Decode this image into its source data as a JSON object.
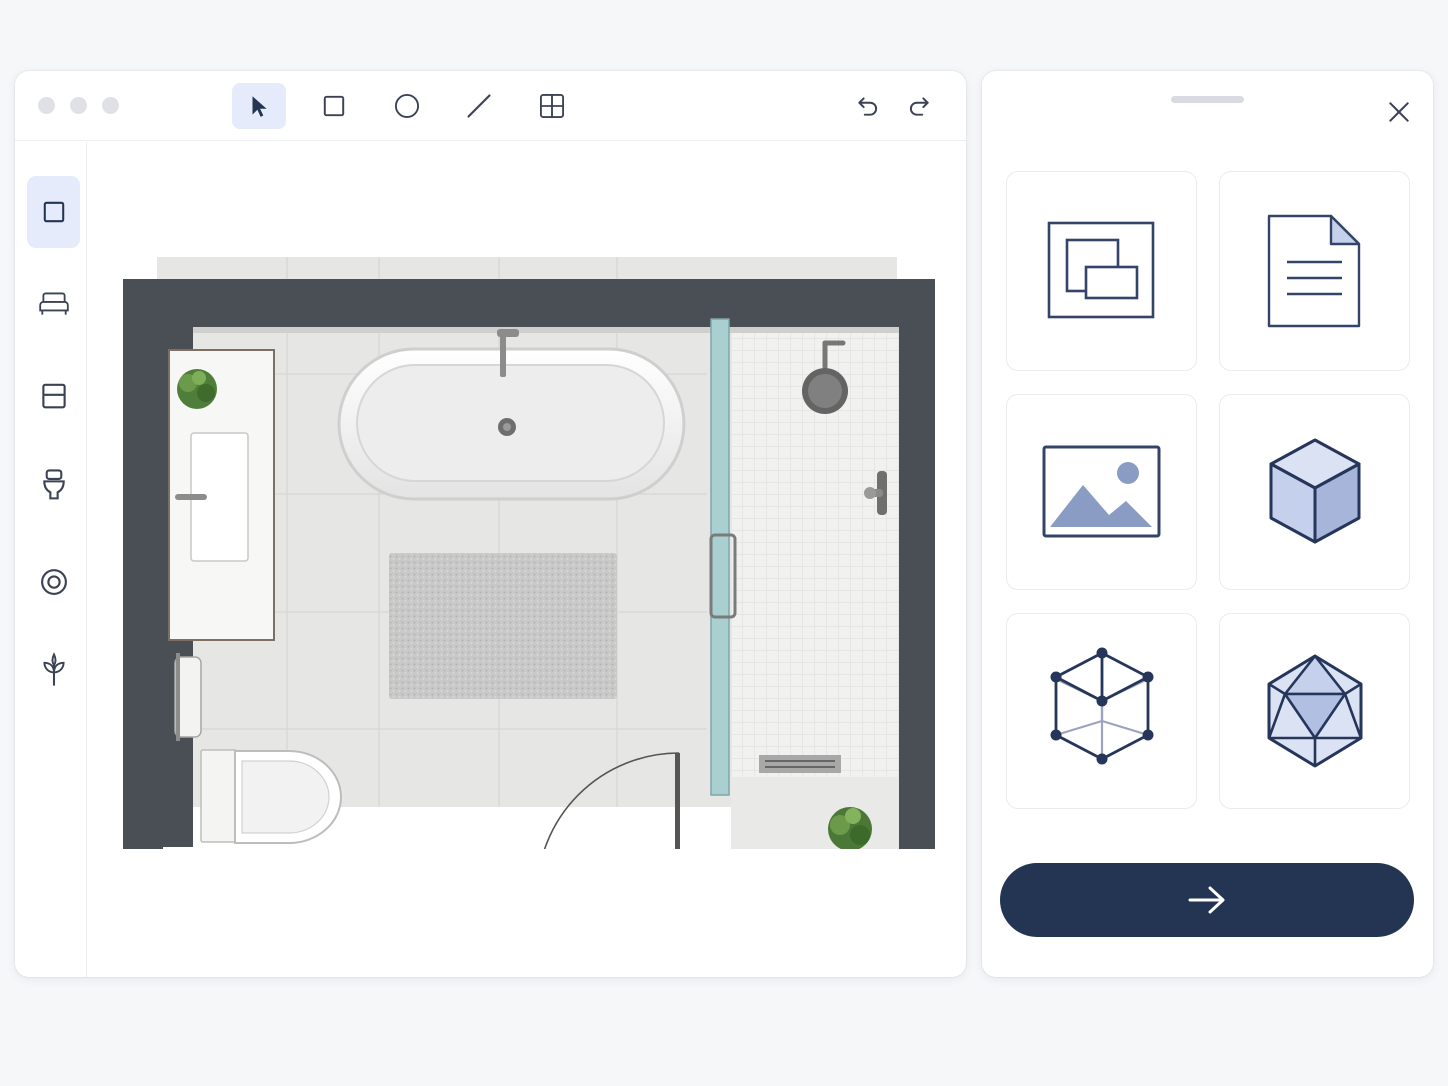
{
  "colors": {
    "accent": "#233553",
    "active_tool_bg": "#e5ebfb",
    "wall": "#4a4f56",
    "glass": "#a9cfd1",
    "icon_stroke": "#344468",
    "icon_fill": "#c5d0ec"
  },
  "window": {
    "controls": [
      "close-dot",
      "minimize-dot",
      "maximize-dot"
    ]
  },
  "toolbar": {
    "tools": [
      {
        "name": "select",
        "icon": "cursor-arrow-icon",
        "active": true
      },
      {
        "name": "rectangle",
        "icon": "square-icon",
        "active": false
      },
      {
        "name": "ellipse",
        "icon": "circle-icon",
        "active": false
      },
      {
        "name": "line",
        "icon": "line-icon",
        "active": false
      },
      {
        "name": "grid",
        "icon": "grid-icon",
        "active": false
      }
    ],
    "history": [
      "undo-icon",
      "redo-icon"
    ]
  },
  "sidebar": {
    "items": [
      {
        "name": "room",
        "icon": "room-square-icon",
        "active": true
      },
      {
        "name": "bed",
        "icon": "bed-icon",
        "active": false
      },
      {
        "name": "cabinet",
        "icon": "cabinet-icon",
        "active": false
      },
      {
        "name": "toilet",
        "icon": "toilet-icon",
        "active": false
      },
      {
        "name": "ring",
        "icon": "target-ring-icon",
        "active": false
      },
      {
        "name": "plant",
        "icon": "plant-icon",
        "active": false
      }
    ]
  },
  "floor_plan": {
    "room": "bathroom",
    "fixtures": [
      "vanity-with-sink",
      "plant",
      "freestanding-bathtub",
      "bath-rug",
      "glass-shower-partition",
      "rain-shower-head",
      "shower-valve",
      "linear-drain",
      "towel-roll",
      "toilet",
      "door-swing",
      "plant"
    ]
  },
  "panel": {
    "options": [
      {
        "name": "layers",
        "icon": "layers-icon"
      },
      {
        "name": "document",
        "icon": "document-icon"
      },
      {
        "name": "image",
        "icon": "image-icon"
      },
      {
        "name": "cube",
        "icon": "cube-icon"
      },
      {
        "name": "wireframe",
        "icon": "wireframe-cube-icon"
      },
      {
        "name": "polyhedron",
        "icon": "icosahedron-icon"
      }
    ],
    "next_icon": "arrow-right-icon"
  }
}
